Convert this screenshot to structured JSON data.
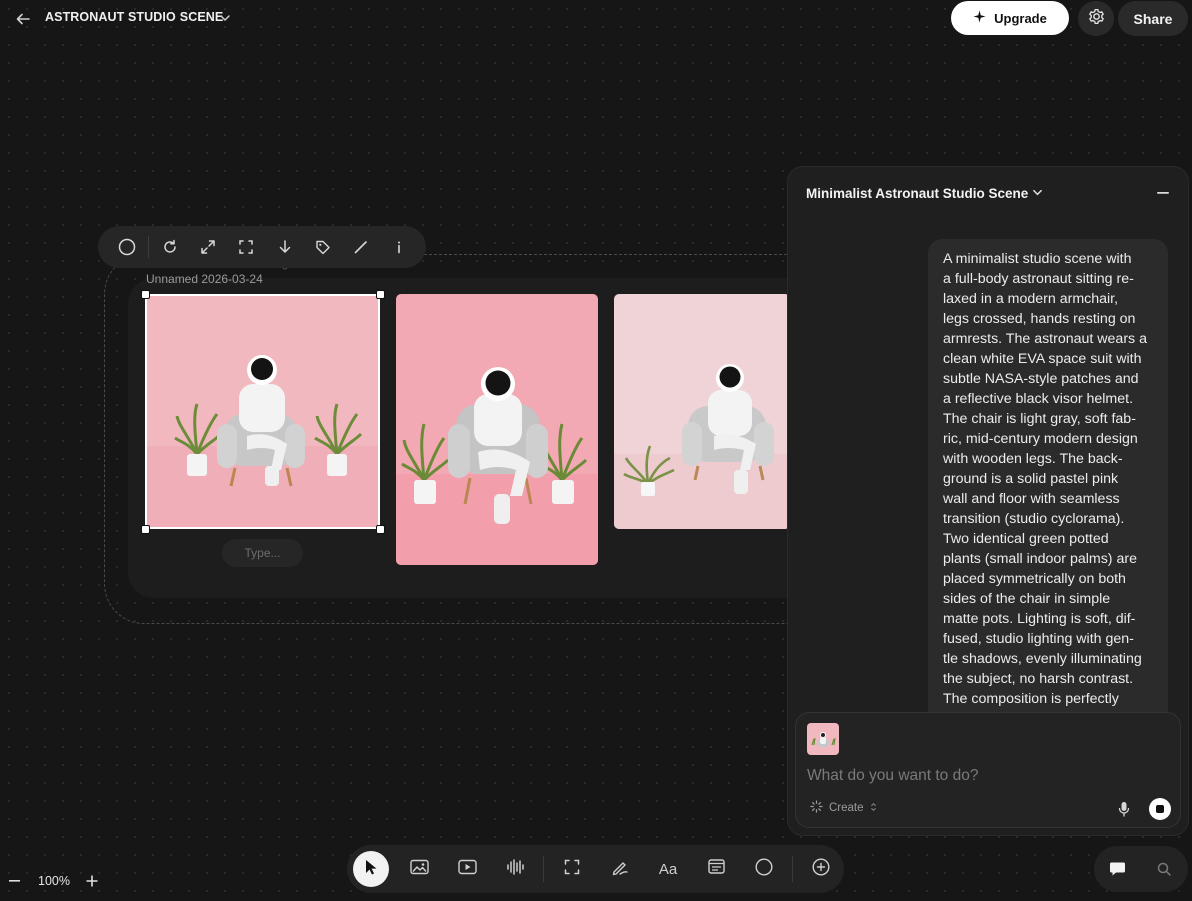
{
  "header": {
    "title_regular": "ASTRONAUT STUDIO",
    "title_bold": "SCENE",
    "upgrade_label": "Upgrade",
    "share_label": "Share"
  },
  "canvas": {
    "group_label": "Minimalist Astronaut Studio Image",
    "item_name": "Unnamed 2026-03-24",
    "type_placeholder": "Type...",
    "toolbar_icons": [
      "circle-icon",
      "refresh-icon",
      "expand-icon",
      "crop-icon",
      "download-icon",
      "tag-icon",
      "pen-icon",
      "info-icon"
    ],
    "images": [
      {
        "description_name": "astronaut-armchair-square",
        "background": "#f2b8bf"
      },
      {
        "description_name": "astronaut-armchair-portrait",
        "background": "#f3a9b3"
      },
      {
        "description_name": "astronaut-armchair-soft",
        "background": "#efd3d6"
      }
    ]
  },
  "chat": {
    "title": "Minimalist Astronaut Studio Scene",
    "message": "A minimalist studio scene with\na full-body astronaut sitting re-\nlaxed in a modern armchair,\nlegs crossed, hands resting on\narmrests. The astronaut wears a\nclean white EVA space suit with\nsubtle NASA-style patches and\na reflective black visor helmet.\nThe chair is light gray, soft fab-\nric, mid-century modern design\nwith wooden legs. The back-\nground is a solid pastel pink\nwall and floor with seamless\ntransition (studio cyclorama).\nTwo identical green potted\nplants (small indoor palms) are\nplaced symmetrically on both\nsides of the chair in simple\nmatte pots. Lighting is soft, dif-\nfused, studio lighting with gen-\ntle shadows, evenly illuminating\nthe subject, no harsh contrast.\nThe composition is perfectly",
    "input_placeholder": "What do you want to do?",
    "mode_label": "Create"
  },
  "bottom_toolbar": {
    "text_tool_label": "Aa",
    "tools": [
      "select-tool",
      "image-tool",
      "video-tool",
      "audio-tool",
      "frame-tool",
      "draw-tool",
      "text-tool",
      "note-tool",
      "shape-tool",
      "add-tool"
    ]
  },
  "zoom": {
    "level": "100%"
  }
}
